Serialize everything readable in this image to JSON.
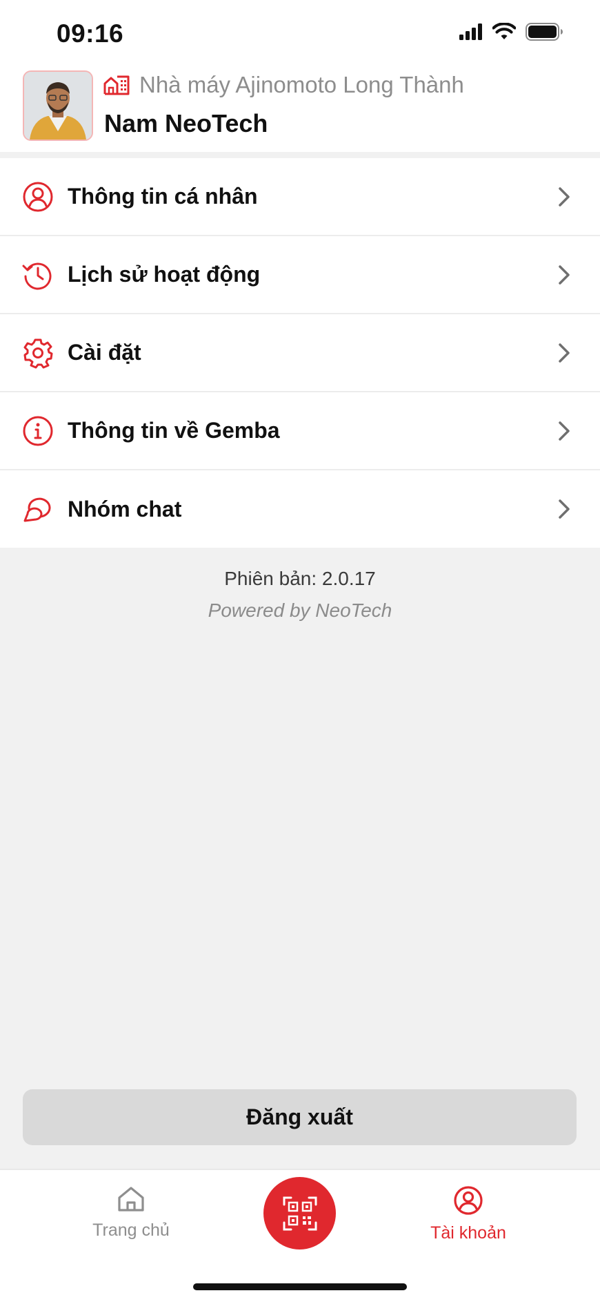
{
  "status_bar": {
    "time": "09:16"
  },
  "header": {
    "factory_name": "Nhà máy Ajinomoto Long Thành",
    "user_name": "Nam NeoTech"
  },
  "menu": {
    "items": [
      {
        "label": "Thông tin cá nhân",
        "icon": "user-circle-icon"
      },
      {
        "label": "Lịch sử hoạt động",
        "icon": "history-icon"
      },
      {
        "label": "Cài đặt",
        "icon": "gear-icon"
      },
      {
        "label": "Thông tin về Gemba",
        "icon": "info-icon"
      },
      {
        "label": "Nhóm chat",
        "icon": "chat-icon"
      }
    ]
  },
  "footer": {
    "version": "Phiên bản: 2.0.17",
    "powered": "Powered by NeoTech"
  },
  "logout_label": "Đăng xuất",
  "tabbar": {
    "home_label": "Trang chủ",
    "account_label": "Tài khoản",
    "active_tab": "account"
  },
  "colors": {
    "accent": "#e0282e",
    "muted": "#8e8e8e",
    "background": "#f1f1f1"
  }
}
